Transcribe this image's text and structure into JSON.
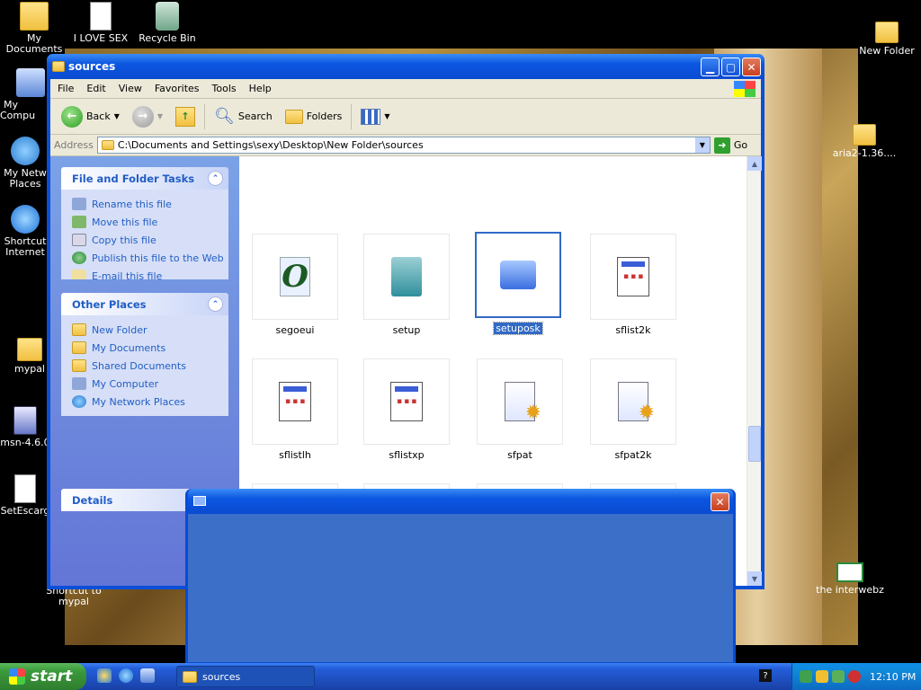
{
  "desktop": {
    "icons": [
      {
        "label": "My Documents"
      },
      {
        "label": "I LOVE SEX"
      },
      {
        "label": "Recycle Bin"
      },
      {
        "label": "New Folder"
      },
      {
        "label": "My Compu"
      },
      {
        "label": "aria2-1.36...."
      },
      {
        "label": "My Netw Places"
      },
      {
        "label": "Shortcut Internet"
      },
      {
        "label": "mypal"
      },
      {
        "label": "msn-4.6.0"
      },
      {
        "label": "SetEscarg"
      },
      {
        "label": "Shortcut to mypal"
      },
      {
        "label": "the interwebz"
      }
    ]
  },
  "window": {
    "title": "sources",
    "menu": [
      "File",
      "Edit",
      "View",
      "Favorites",
      "Tools",
      "Help"
    ],
    "toolbar": {
      "back": "Back",
      "search": "Search",
      "folders": "Folders"
    },
    "address": {
      "label": "Address",
      "value": "C:\\Documents and Settings\\sexy\\Desktop\\New Folder\\sources",
      "go": "Go"
    },
    "tasks": {
      "file_tasks": {
        "title": "File and Folder Tasks",
        "items": [
          "Rename this file",
          "Move this file",
          "Copy this file",
          "Publish this file to the Web",
          "E-mail this file"
        ]
      },
      "other_places": {
        "title": "Other Places",
        "items": [
          "New Folder",
          "My Documents",
          "Shared Documents",
          "My Computer",
          "My Network Places"
        ]
      },
      "details": {
        "title": "Details"
      }
    },
    "files": [
      {
        "name": "segoeui",
        "icon": "font-icon"
      },
      {
        "name": "setup",
        "icon": "setup-icon"
      },
      {
        "name": "setuposk",
        "icon": "osk-icon",
        "selected": true
      },
      {
        "name": "sflist2k",
        "icon": "document-icon"
      },
      {
        "name": "sflistlh",
        "icon": "document-icon"
      },
      {
        "name": "sflistxp",
        "icon": "document-icon"
      },
      {
        "name": "sfpat",
        "icon": "setup-info-icon"
      },
      {
        "name": "sfpat2k",
        "icon": "setup-info-icon"
      },
      {
        "name": "",
        "icon": "setup-info-icon"
      },
      {
        "name": "",
        "icon": "setup-info-icon"
      },
      {
        "name": "",
        "icon": "script-icon"
      },
      {
        "name": "",
        "icon": "script-icon"
      }
    ]
  },
  "taskbar": {
    "start": "start",
    "task_button": "sources",
    "help": "?",
    "clock": "12:10 PM"
  },
  "colors": {
    "xp_blue": "#0a4bd0",
    "selection": "#316ac5",
    "start_green": "#3a9a3a"
  }
}
